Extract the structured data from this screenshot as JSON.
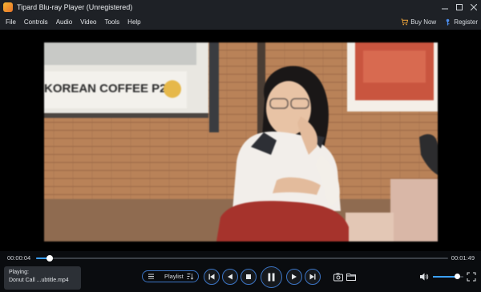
{
  "window": {
    "title": "Tipard Blu-ray Player (Unregistered)"
  },
  "menu": {
    "items": [
      "File",
      "Controls",
      "Audio",
      "Video",
      "Tools",
      "Help"
    ],
    "buy_now": "Buy Now",
    "register": "Register"
  },
  "video": {
    "sign_text": "KOREAN COFFEE P20"
  },
  "playback": {
    "current_time": "00:00:04",
    "total_time": "00:01:49",
    "progress_fraction": 0.033,
    "volume_fraction": 0.8
  },
  "now_playing": {
    "label": "Playing:",
    "file": "Donut Call ...ubtitle.mp4"
  },
  "playlist": {
    "label": "Playlist"
  },
  "colors": {
    "accent": "#3ba0ff",
    "button_border": "#3b74c4",
    "background": "#0a0c0f",
    "bar": "#1e2126"
  }
}
